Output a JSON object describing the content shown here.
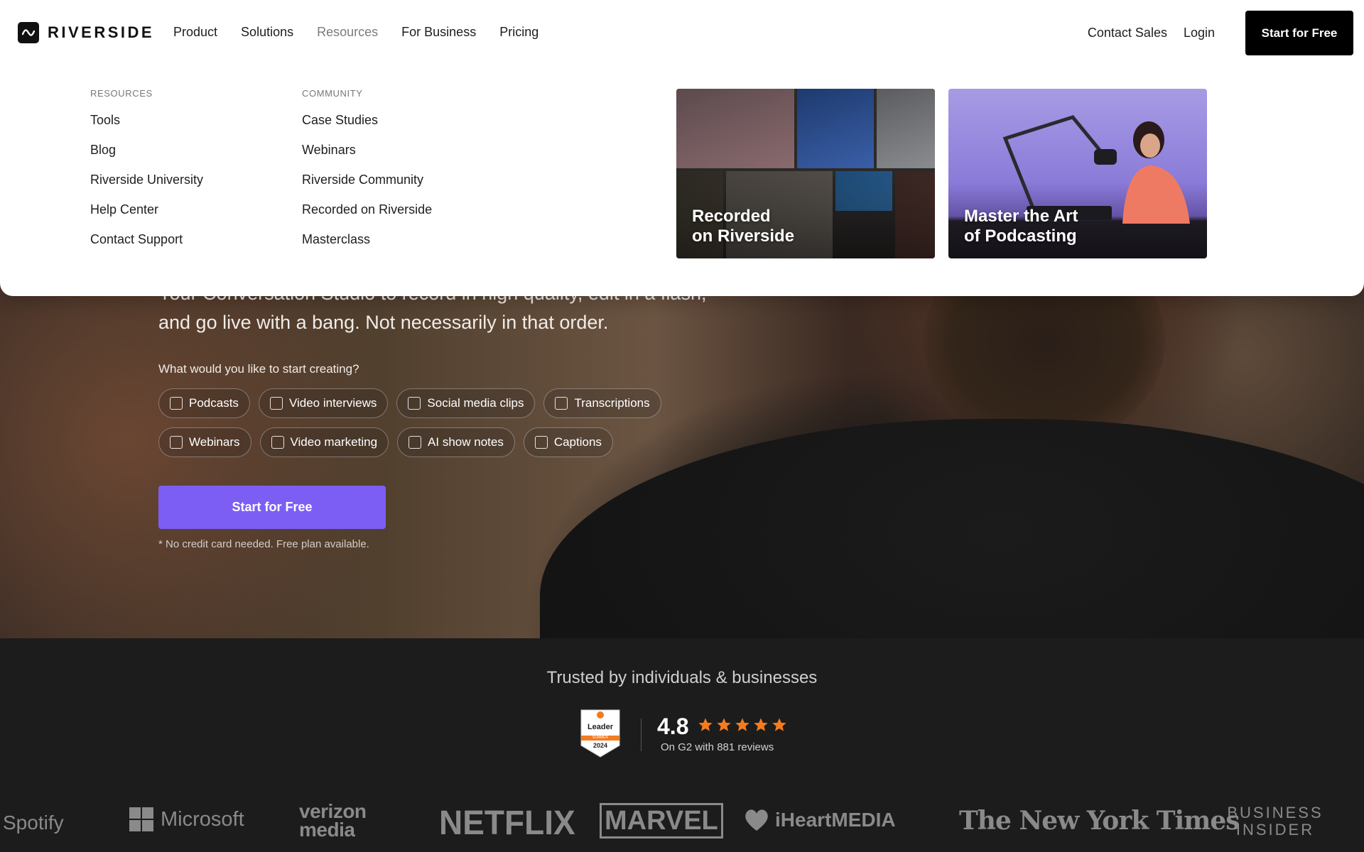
{
  "nav": {
    "logo_text": "RIVERSIDE",
    "links": [
      "Product",
      "Solutions",
      "Resources",
      "For Business",
      "Pricing"
    ],
    "active_link": "Resources",
    "contact_sales": "Contact Sales",
    "login": "Login",
    "cta": "Start for Free"
  },
  "dropdown": {
    "resources": {
      "heading": "RESOURCES",
      "items": [
        "Tools",
        "Blog",
        "Riverside University",
        "Help Center",
        "Contact Support"
      ]
    },
    "community": {
      "heading": "COMMUNITY",
      "items": [
        "Case Studies",
        "Webinars",
        "Riverside Community",
        "Recorded on Riverside",
        "Masterclass"
      ]
    },
    "cards": [
      {
        "title_line1": "Recorded",
        "title_line2": "on Riverside"
      },
      {
        "title_line1": "Master the Art",
        "title_line2": "of Podcasting"
      }
    ]
  },
  "hero": {
    "subtitle_line1": "Your Conversation Studio to record in high quality, edit in a flash,",
    "subtitle_line2": "and go live with a bang. Not necessarily in that order.",
    "question": "What would you like to start creating?",
    "chips_row1": [
      "Podcasts",
      "Video interviews",
      "Social media clips",
      "Transcriptions"
    ],
    "chips_row2": [
      "Webinars",
      "Video marketing",
      "AI show notes",
      "Captions"
    ],
    "cta": "Start for Free",
    "note": "* No credit card needed. Free plan available."
  },
  "trusted": {
    "title": "Trusted by individuals & businesses",
    "badge": {
      "label": "Leader",
      "season": "SUMMER",
      "year": "2024"
    },
    "score": "4.8",
    "stars": 5,
    "star_color": "#f47b20",
    "sub": "On G2 with 881 reviews",
    "logos": [
      "Spotify",
      "Microsoft",
      "verizon media",
      "NETFLIX",
      "MARVEL",
      "iHeartMEDIA",
      "The New York Times",
      "BUSINESS INSIDER"
    ]
  },
  "colors": {
    "primary": "#7c5ef5",
    "dark": "#000000",
    "footer_bg": "#1c1c1c"
  }
}
